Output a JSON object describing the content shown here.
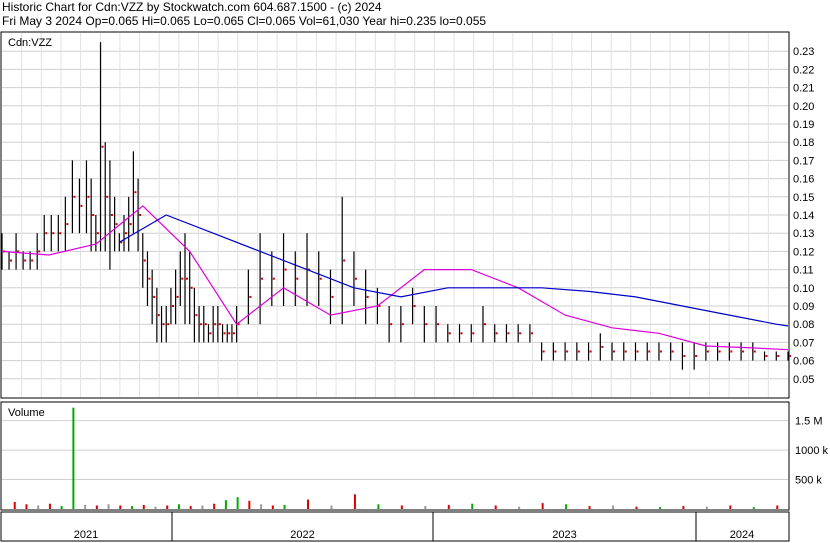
{
  "header": {
    "line1": "Historic Chart for Cdn:VZZ by Stockwatch.com 604.687.1500 - (c) 2024",
    "line2": "Fri May  3 2024  Op=0.065  Hi=0.065  Lo=0.065  Cl=0.065  Vol=61,030  Year hi=0.235  lo=0.055"
  },
  "price_panel": {
    "label": "Cdn:VZZ"
  },
  "volume_panel": {
    "label": "Volume"
  },
  "chart_data": [
    {
      "type": "line",
      "title": "Cdn:VZZ",
      "y_ticks": [
        "0.23",
        "0.22",
        "0.21",
        "0.20",
        "0.19",
        "0.18",
        "0.17",
        "0.16",
        "0.15",
        "0.14",
        "0.13",
        "0.12",
        "0.11",
        "0.10",
        "0.09",
        "0.08",
        "0.07",
        "0.06",
        "0.05"
      ],
      "ylim": [
        0.04,
        0.24
      ],
      "x_labels": [
        "2021",
        "2022",
        "2023",
        "2024"
      ],
      "grid": true,
      "colors": {
        "price_bar": "#000000",
        "close_dot": "#cc0000",
        "short_ma": "#dd00dd",
        "long_ma": "#0000cc"
      },
      "series": [
        {
          "name": "",
          "kind": "ohlc-approx",
          "x": [
            0.0,
            0.03,
            0.06,
            0.09,
            0.12,
            0.15,
            0.18,
            0.21,
            0.24,
            0.27,
            0.3,
            0.33,
            0.36,
            0.38,
            0.4,
            0.42,
            0.44,
            0.46,
            0.48,
            0.5,
            0.52,
            0.54,
            0.56,
            0.58,
            0.6,
            0.62,
            0.64,
            0.66,
            0.68,
            0.7,
            0.72,
            0.74,
            0.76,
            0.78,
            0.8,
            0.82,
            0.84,
            0.86,
            0.88,
            0.9,
            0.92,
            0.94,
            0.96,
            0.98,
            1.0,
            1.05,
            1.1,
            1.15,
            1.2,
            1.25,
            1.3,
            1.35,
            1.4,
            1.45,
            1.5,
            1.55,
            1.6,
            1.65,
            1.7,
            1.75,
            1.8,
            1.85,
            1.9,
            1.95,
            2.0,
            2.05,
            2.1,
            2.15,
            2.2,
            2.25,
            2.3,
            2.35,
            2.4,
            2.45,
            2.5,
            2.55,
            2.6,
            2.65,
            2.7,
            2.75,
            2.8,
            2.85,
            2.9,
            2.95,
            3.0,
            3.05,
            3.1,
            3.15,
            3.2,
            3.25,
            3.3,
            3.35
          ],
          "high": [
            0.13,
            0.12,
            0.13,
            0.12,
            0.12,
            0.13,
            0.14,
            0.14,
            0.14,
            0.15,
            0.17,
            0.16,
            0.17,
            0.16,
            0.14,
            0.235,
            0.18,
            0.17,
            0.15,
            0.13,
            0.14,
            0.15,
            0.175,
            0.16,
            0.13,
            0.12,
            0.11,
            0.1,
            0.09,
            0.09,
            0.1,
            0.11,
            0.12,
            0.13,
            0.12,
            0.1,
            0.09,
            0.09,
            0.08,
            0.09,
            0.09,
            0.08,
            0.08,
            0.08,
            0.09,
            0.11,
            0.13,
            0.12,
            0.13,
            0.12,
            0.13,
            0.12,
            0.11,
            0.15,
            0.12,
            0.11,
            0.1,
            0.09,
            0.09,
            0.1,
            0.09,
            0.09,
            0.08,
            0.08,
            0.08,
            0.09,
            0.08,
            0.08,
            0.08,
            0.08,
            0.07,
            0.07,
            0.07,
            0.07,
            0.07,
            0.075,
            0.07,
            0.07,
            0.07,
            0.07,
            0.07,
            0.07,
            0.07,
            0.07,
            0.07,
            0.07,
            0.07,
            0.07,
            0.07,
            0.065,
            0.065,
            0.065
          ],
          "low": [
            0.11,
            0.11,
            0.11,
            0.11,
            0.11,
            0.11,
            0.12,
            0.12,
            0.12,
            0.12,
            0.13,
            0.13,
            0.13,
            0.12,
            0.12,
            0.12,
            0.12,
            0.11,
            0.12,
            0.12,
            0.12,
            0.12,
            0.13,
            0.12,
            0.1,
            0.09,
            0.08,
            0.07,
            0.07,
            0.07,
            0.08,
            0.08,
            0.09,
            0.08,
            0.08,
            0.07,
            0.07,
            0.07,
            0.07,
            0.07,
            0.07,
            0.07,
            0.07,
            0.07,
            0.07,
            0.08,
            0.08,
            0.09,
            0.09,
            0.09,
            0.09,
            0.09,
            0.08,
            0.08,
            0.09,
            0.08,
            0.08,
            0.07,
            0.07,
            0.08,
            0.07,
            0.07,
            0.07,
            0.07,
            0.07,
            0.07,
            0.07,
            0.07,
            0.07,
            0.07,
            0.06,
            0.06,
            0.06,
            0.06,
            0.06,
            0.06,
            0.06,
            0.06,
            0.06,
            0.06,
            0.06,
            0.06,
            0.055,
            0.055,
            0.06,
            0.06,
            0.06,
            0.06,
            0.06,
            0.06,
            0.06,
            0.06
          ]
        },
        {
          "name": "",
          "kind": "moving-average-short",
          "x": [
            0.0,
            0.2,
            0.4,
            0.6,
            0.8,
            1.0,
            1.2,
            1.4,
            1.6,
            1.8,
            2.0,
            2.2,
            2.4,
            2.6,
            2.8,
            3.0,
            3.2,
            3.35
          ],
          "y": [
            0.12,
            0.118,
            0.124,
            0.145,
            0.12,
            0.08,
            0.1,
            0.085,
            0.09,
            0.11,
            0.11,
            0.1,
            0.085,
            0.078,
            0.075,
            0.068,
            0.067,
            0.066
          ]
        },
        {
          "name": "",
          "kind": "moving-average-long",
          "x": [
            0.5,
            0.7,
            0.9,
            1.1,
            1.3,
            1.5,
            1.7,
            1.9,
            2.1,
            2.3,
            2.5,
            2.7,
            2.9,
            3.1,
            3.3,
            3.35
          ],
          "y": [
            0.125,
            0.14,
            0.13,
            0.12,
            0.11,
            0.1,
            0.095,
            0.1,
            0.1,
            0.1,
            0.098,
            0.095,
            0.09,
            0.085,
            0.08,
            0.079
          ]
        }
      ]
    },
    {
      "type": "bar",
      "title": "Volume",
      "y_ticks": [
        "1.5 M",
        "1000 k",
        "500 k"
      ],
      "ylim": [
        0,
        1800
      ],
      "note_units": "thousands of shares",
      "colors": {
        "up": "#00aa00",
        "down": "#dd0000",
        "flat": "#999999"
      },
      "bars": [
        {
          "x": 0.05,
          "v": 120,
          "c": "down"
        },
        {
          "x": 0.1,
          "v": 80,
          "c": "down"
        },
        {
          "x": 0.15,
          "v": 60,
          "c": "flat"
        },
        {
          "x": 0.2,
          "v": 90,
          "c": "down"
        },
        {
          "x": 0.25,
          "v": 50,
          "c": "up"
        },
        {
          "x": 0.3,
          "v": 1720,
          "c": "up"
        },
        {
          "x": 0.35,
          "v": 70,
          "c": "flat"
        },
        {
          "x": 0.4,
          "v": 60,
          "c": "down"
        },
        {
          "x": 0.45,
          "v": 80,
          "c": "flat"
        },
        {
          "x": 0.5,
          "v": 60,
          "c": "down"
        },
        {
          "x": 0.55,
          "v": 50,
          "c": "up"
        },
        {
          "x": 0.6,
          "v": 70,
          "c": "down"
        },
        {
          "x": 0.65,
          "v": 40,
          "c": "flat"
        },
        {
          "x": 0.7,
          "v": 60,
          "c": "down"
        },
        {
          "x": 0.75,
          "v": 80,
          "c": "up"
        },
        {
          "x": 0.8,
          "v": 50,
          "c": "down"
        },
        {
          "x": 0.85,
          "v": 60,
          "c": "flat"
        },
        {
          "x": 0.9,
          "v": 90,
          "c": "down"
        },
        {
          "x": 0.95,
          "v": 150,
          "c": "up"
        },
        {
          "x": 1.0,
          "v": 200,
          "c": "up"
        },
        {
          "x": 1.05,
          "v": 140,
          "c": "down"
        },
        {
          "x": 1.1,
          "v": 80,
          "c": "flat"
        },
        {
          "x": 1.15,
          "v": 60,
          "c": "down"
        },
        {
          "x": 1.2,
          "v": 70,
          "c": "up"
        },
        {
          "x": 1.3,
          "v": 160,
          "c": "down"
        },
        {
          "x": 1.4,
          "v": 60,
          "c": "flat"
        },
        {
          "x": 1.5,
          "v": 250,
          "c": "down"
        },
        {
          "x": 1.6,
          "v": 80,
          "c": "up"
        },
        {
          "x": 1.7,
          "v": 60,
          "c": "down"
        },
        {
          "x": 1.8,
          "v": 50,
          "c": "flat"
        },
        {
          "x": 1.9,
          "v": 70,
          "c": "down"
        },
        {
          "x": 2.0,
          "v": 90,
          "c": "up"
        },
        {
          "x": 2.1,
          "v": 60,
          "c": "down"
        },
        {
          "x": 2.2,
          "v": 40,
          "c": "flat"
        },
        {
          "x": 2.3,
          "v": 100,
          "c": "down"
        },
        {
          "x": 2.4,
          "v": 80,
          "c": "up"
        },
        {
          "x": 2.5,
          "v": 50,
          "c": "down"
        },
        {
          "x": 2.6,
          "v": 60,
          "c": "flat"
        },
        {
          "x": 2.7,
          "v": 40,
          "c": "down"
        },
        {
          "x": 2.8,
          "v": 30,
          "c": "up"
        },
        {
          "x": 2.9,
          "v": 50,
          "c": "down"
        },
        {
          "x": 3.0,
          "v": 40,
          "c": "flat"
        },
        {
          "x": 3.1,
          "v": 60,
          "c": "down"
        },
        {
          "x": 3.2,
          "v": 30,
          "c": "up"
        },
        {
          "x": 3.3,
          "v": 60,
          "c": "down"
        }
      ]
    }
  ]
}
